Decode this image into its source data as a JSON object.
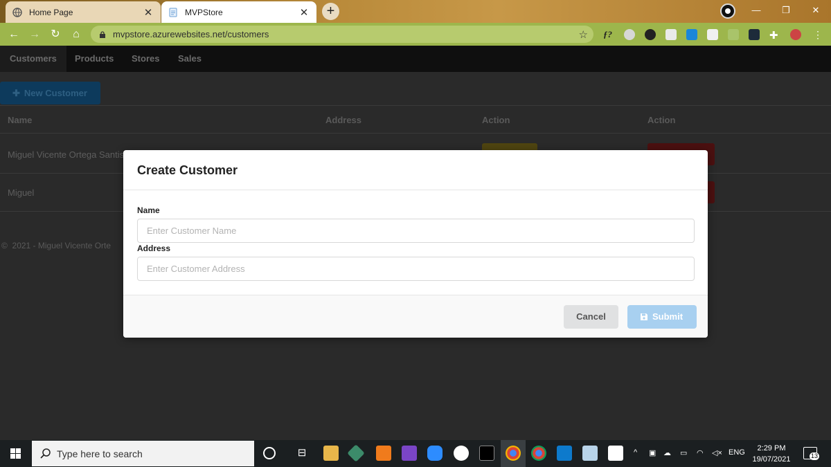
{
  "browser": {
    "tabs": [
      {
        "label": "Home Page",
        "active": false
      },
      {
        "label": "MVPStore",
        "active": true
      }
    ],
    "new_tab_glyph": "+",
    "url": "mvpstore.azurewebsites.net/customers",
    "theme_color": "#9db64c"
  },
  "app_nav": {
    "items": [
      "Customers",
      "Products",
      "Stores",
      "Sales"
    ],
    "active": "Customers"
  },
  "page": {
    "new_button_label": "New Customer",
    "table": {
      "headers": [
        "Name",
        "Address",
        "Action",
        "Action"
      ],
      "rows": [
        {
          "name": "Miguel Vicente Ortega Santis"
        },
        {
          "name": "Miguel"
        }
      ]
    },
    "footer": "2021 - Miguel Vicente Orte"
  },
  "modal": {
    "title": "Create Customer",
    "name_label": "Name",
    "name_placeholder": "Enter Customer Name",
    "address_label": "Address",
    "address_placeholder": "Enter Customer Address",
    "cancel_label": "Cancel",
    "submit_label": "Submit",
    "submit_color": "#a8d0f0"
  },
  "taskbar": {
    "search_placeholder": "Type here to search",
    "language": "ENG",
    "time": "2:29 PM",
    "date": "19/07/2021",
    "notification_count": "13"
  }
}
